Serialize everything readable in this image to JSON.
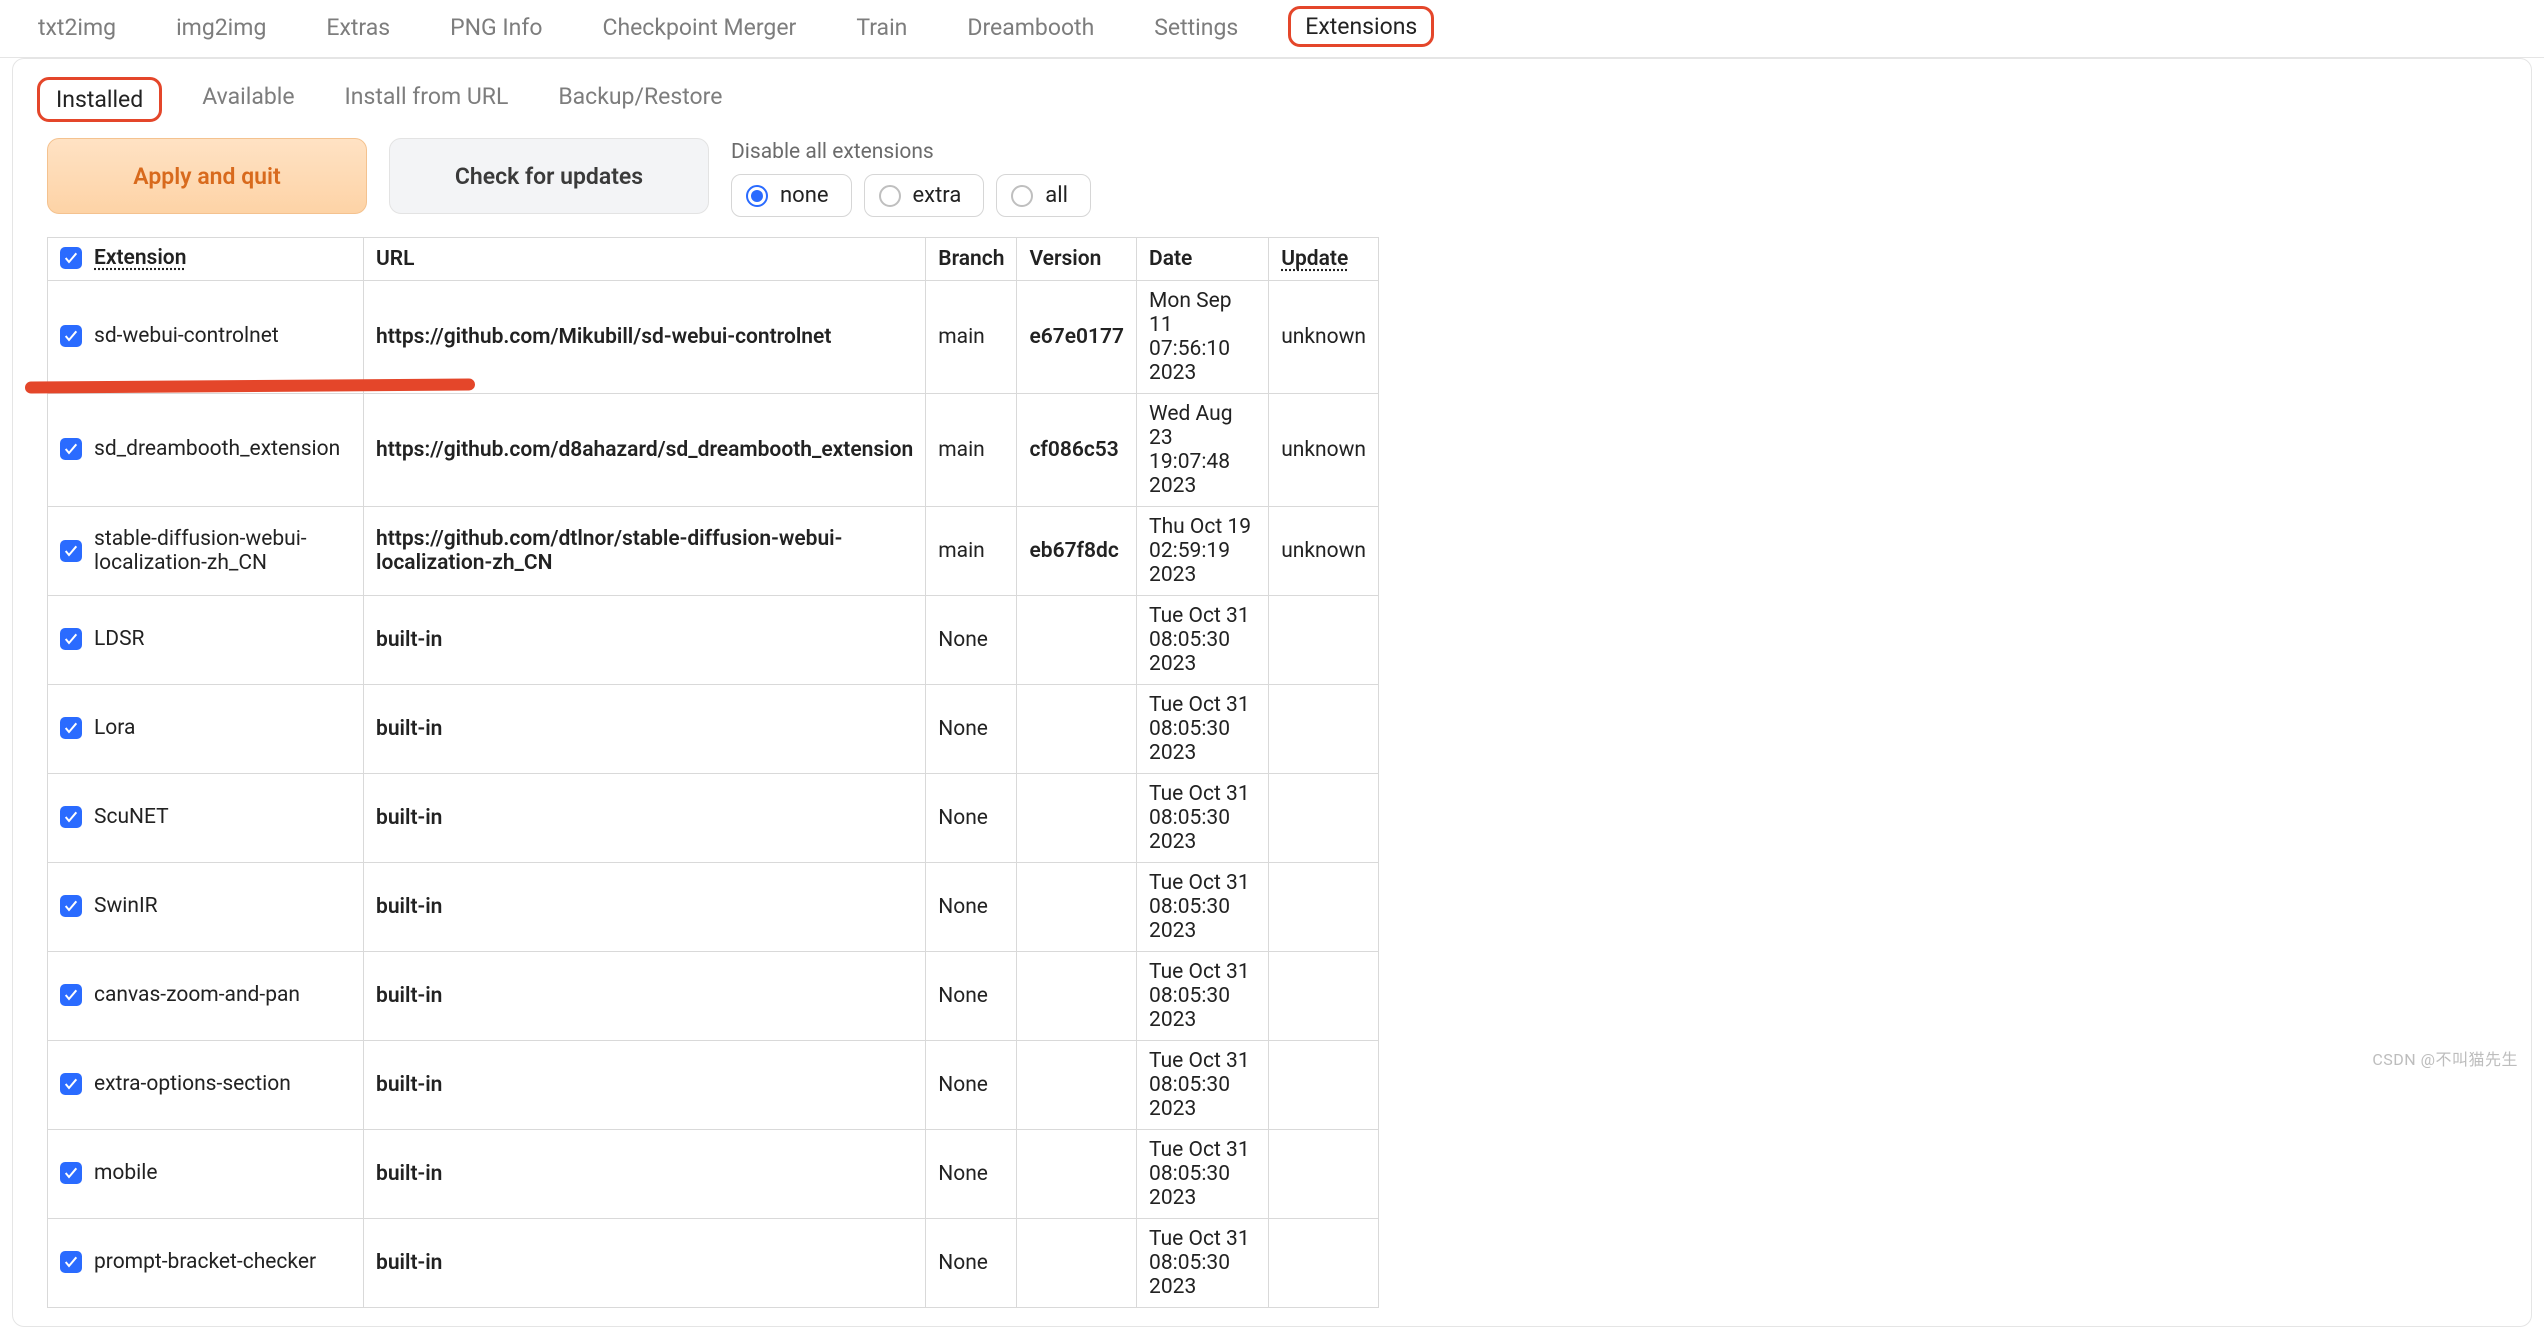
{
  "mainTabs": [
    {
      "label": "txt2img"
    },
    {
      "label": "img2img"
    },
    {
      "label": "Extras"
    },
    {
      "label": "PNG Info"
    },
    {
      "label": "Checkpoint Merger"
    },
    {
      "label": "Train"
    },
    {
      "label": "Dreambooth"
    },
    {
      "label": "Settings"
    },
    {
      "label": "Extensions",
      "active": true
    }
  ],
  "subTabs": [
    {
      "label": "Installed",
      "active": true
    },
    {
      "label": "Available"
    },
    {
      "label": "Install from URL"
    },
    {
      "label": "Backup/Restore"
    }
  ],
  "buttons": {
    "apply": "Apply and quit",
    "check": "Check for updates"
  },
  "disable": {
    "label": "Disable all extensions",
    "options": [
      "none",
      "extra",
      "all"
    ],
    "selected": "none"
  },
  "columns": {
    "extension": "Extension",
    "url": "URL",
    "branch": "Branch",
    "version": "Version",
    "date": "Date",
    "update": "Update"
  },
  "rows": [
    {
      "name": "sd-webui-controlnet",
      "url": "https://github.com/Mikubill/sd-webui-controlnet",
      "branch": "main",
      "version": "e67e0177",
      "date": "Mon Sep 11 07:56:10 2023",
      "update": "unknown"
    },
    {
      "name": "sd_dreambooth_extension",
      "url": "https://github.com/d8ahazard/sd_dreambooth_extension",
      "branch": "main",
      "version": "cf086c53",
      "date": "Wed Aug 23 19:07:48 2023",
      "update": "unknown"
    },
    {
      "name": "stable-diffusion-webui-localization-zh_CN",
      "url": "https://github.com/dtlnor/stable-diffusion-webui-localization-zh_CN",
      "branch": "main",
      "version": "eb67f8dc",
      "date": "Thu Oct 19 02:59:19 2023",
      "update": "unknown"
    },
    {
      "name": "LDSR",
      "url": "built-in",
      "branch": "None",
      "version": "",
      "date": "Tue Oct 31 08:05:30 2023",
      "update": ""
    },
    {
      "name": "Lora",
      "url": "built-in",
      "branch": "None",
      "version": "",
      "date": "Tue Oct 31 08:05:30 2023",
      "update": ""
    },
    {
      "name": "ScuNET",
      "url": "built-in",
      "branch": "None",
      "version": "",
      "date": "Tue Oct 31 08:05:30 2023",
      "update": ""
    },
    {
      "name": "SwinIR",
      "url": "built-in",
      "branch": "None",
      "version": "",
      "date": "Tue Oct 31 08:05:30 2023",
      "update": ""
    },
    {
      "name": "canvas-zoom-and-pan",
      "url": "built-in",
      "branch": "None",
      "version": "",
      "date": "Tue Oct 31 08:05:30 2023",
      "update": ""
    },
    {
      "name": "extra-options-section",
      "url": "built-in",
      "branch": "None",
      "version": "",
      "date": "Tue Oct 31 08:05:30 2023",
      "update": ""
    },
    {
      "name": "mobile",
      "url": "built-in",
      "branch": "None",
      "version": "",
      "date": "Tue Oct 31 08:05:30 2023",
      "update": ""
    },
    {
      "name": "prompt-bracket-checker",
      "url": "built-in",
      "branch": "None",
      "version": "",
      "date": "Tue Oct 31 08:05:30 2023",
      "update": ""
    }
  ],
  "watermark": "CSDN @不叫猫先生"
}
